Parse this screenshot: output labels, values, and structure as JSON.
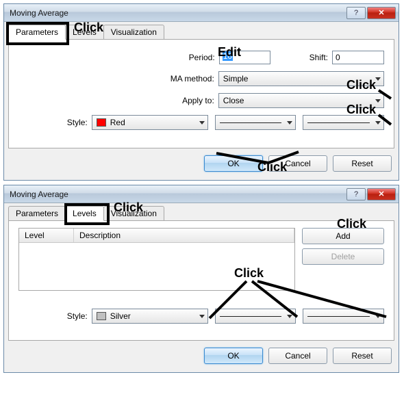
{
  "annotations": {
    "click": "Click",
    "edit": "Edit"
  },
  "dialog1": {
    "title": "Moving Average",
    "tabs": {
      "parameters": "Parameters",
      "levels": "Levels",
      "visualization": "Visualization"
    },
    "labels": {
      "period": "Period:",
      "shift": "Shift:",
      "ma_method": "MA method:",
      "apply_to": "Apply to:",
      "style": "Style:"
    },
    "values": {
      "period": "10",
      "shift": "0",
      "ma_method": "Simple",
      "apply_to": "Close",
      "style_color_name": "Red",
      "style_color_hex": "#ff0000"
    },
    "buttons": {
      "ok": "OK",
      "cancel": "Cancel",
      "reset": "Reset"
    }
  },
  "dialog2": {
    "title": "Moving Average",
    "tabs": {
      "parameters": "Parameters",
      "levels": "Levels",
      "visualization": "Visualization"
    },
    "list": {
      "col_level": "Level",
      "col_desc": "Description"
    },
    "labels": {
      "style": "Style:"
    },
    "values": {
      "style_color_name": "Silver",
      "style_color_hex": "#c0c0c0"
    },
    "side": {
      "add": "Add",
      "delete": "Delete"
    },
    "buttons": {
      "ok": "OK",
      "cancel": "Cancel",
      "reset": "Reset"
    }
  }
}
